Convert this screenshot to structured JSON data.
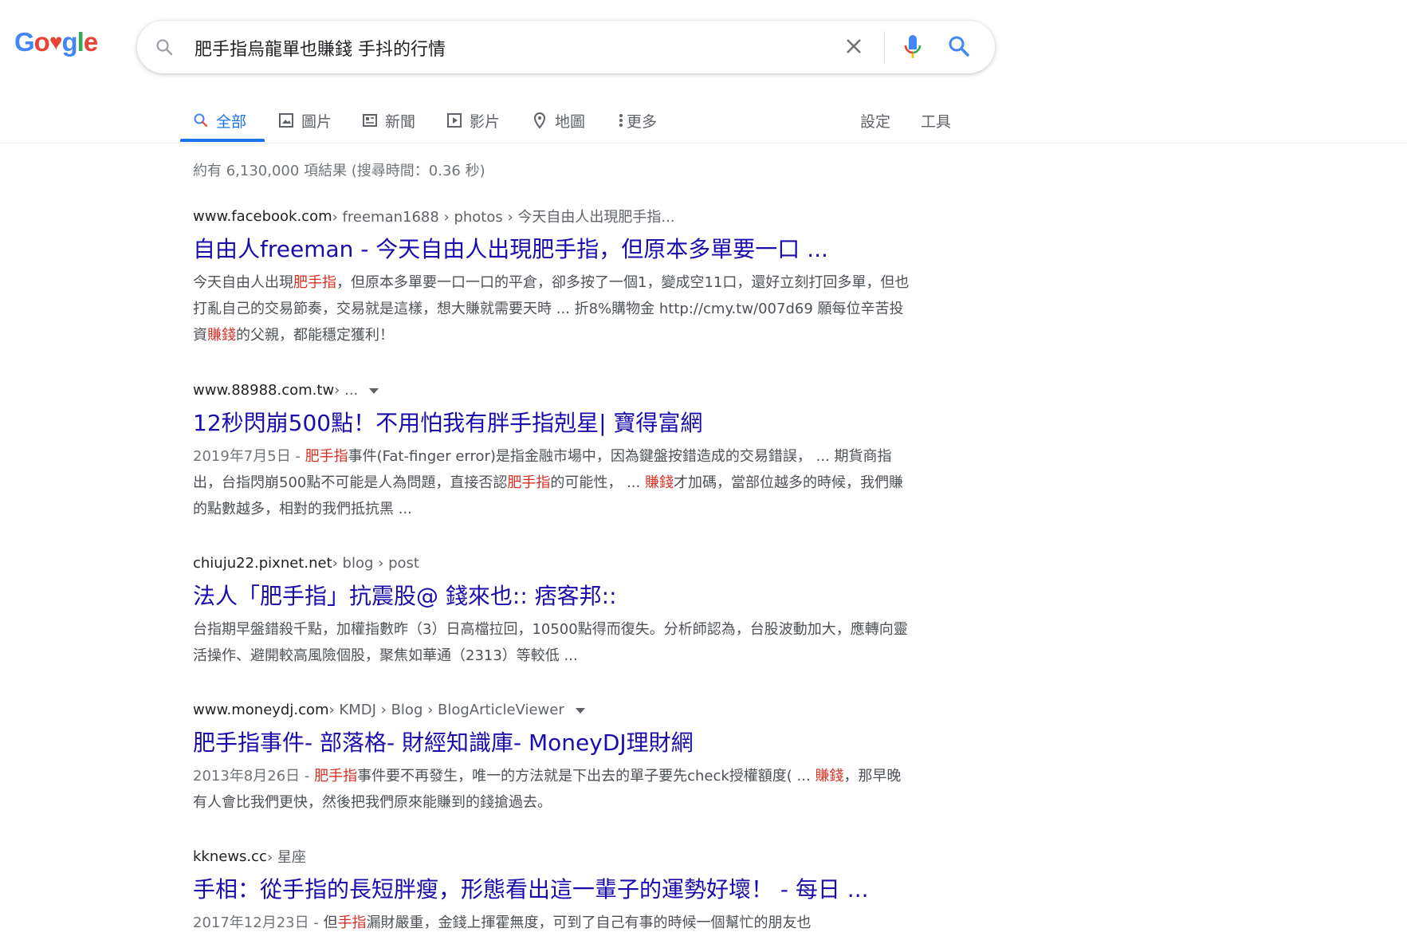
{
  "logo": {
    "letters": [
      "G",
      "o",
      "♥",
      "g",
      "l",
      "e"
    ],
    "colors": [
      "#4285f4",
      "#ea4335",
      "#ea4335",
      "#4285f4",
      "#34a853",
      "#ea4335"
    ]
  },
  "search": {
    "query": "肥手指烏龍單也賺錢 手抖的行情"
  },
  "tabs": [
    {
      "label": "全部",
      "icon": "search-icon"
    },
    {
      "label": "圖片",
      "icon": "image-icon"
    },
    {
      "label": "新聞",
      "icon": "news-icon"
    },
    {
      "label": "影片",
      "icon": "video-icon"
    },
    {
      "label": "地圖",
      "icon": "map-pin-icon"
    },
    {
      "label": "更多",
      "icon": "more-vert-icon"
    }
  ],
  "tab_right": {
    "settings": "設定",
    "tools": "工具"
  },
  "stats": "約有 6,130,000 項結果 (搜尋時間：0.36 秒)",
  "results": [
    {
      "site": "www.facebook.com",
      "path": " › freeman1688 › photos › 今天自由人出現肥手指...",
      "title": "自由人freeman - 今天自由人出現肥手指，但原本多單要一口 ...",
      "snippet": [
        {
          "t": "今天自由人出現"
        },
        {
          "t": "肥手指",
          "hl": true
        },
        {
          "t": "，但原本多單要一口一口的平倉，卻多按了一個1，變成空11口，還好立刻打回多單，但也打亂自己的交易節奏，交易就是這樣，想大賺就需要天時 ... 折8%購物金 http://cmy.tw/007d69 願每位辛苦投資"
        },
        {
          "t": "賺錢",
          "hl": true
        },
        {
          "t": "的父親，都能穩定獲利！"
        }
      ]
    },
    {
      "site": "www.88988.com.tw",
      "path": " › ...",
      "caret": true,
      "title": "12秒閃崩500點！不用怕我有胖手指剋星| 寶得富網",
      "date": "2019年7月5日 - ",
      "snippet": [
        {
          "t": "肥手指",
          "hl": true
        },
        {
          "t": "事件(Fat-finger error)是指金融市場中，因為鍵盤按錯造成的交易錯誤， ... 期貨商指出，台指閃崩500點不可能是人為問題，直接否認"
        },
        {
          "t": "肥手指",
          "hl": true
        },
        {
          "t": "的可能性， ... "
        },
        {
          "t": "賺錢",
          "hl": true
        },
        {
          "t": "才加碼，當部位越多的時候，我們賺的點數越多，相對的我們抵抗黑 ..."
        }
      ]
    },
    {
      "site": "chiuju22.pixnet.net",
      "path": " › blog › post",
      "title": "法人「肥手指」抗震股@ 錢來也:: 痞客邦::",
      "snippet": [
        {
          "t": "台指期早盤錯殺千點，加權指數昨（3）日高檔拉回，10500點得而復失。分析師認為，台股波動加大，應轉向靈活操作、避開較高風險個股，聚焦如華通（2313）等較低 ..."
        }
      ]
    },
    {
      "site": "www.moneydj.com",
      "path": " › KMDJ › Blog › BlogArticleViewer",
      "caret": true,
      "title": "肥手指事件- 部落格- 財經知識庫- MoneyDJ理財網",
      "date": "2013年8月26日 - ",
      "snippet": [
        {
          "t": "肥手指",
          "hl": true
        },
        {
          "t": "事件要不再發生，唯一的方法就是下出去的單子要先check授權額度( ... "
        },
        {
          "t": "賺錢",
          "hl": true
        },
        {
          "t": "，那早晚有人會比我們更快，然後把我們原來能賺到的錢搶過去。"
        }
      ]
    },
    {
      "site": "kknews.cc",
      "path": " › 星座",
      "title": "手相：從手指的長短胖瘦，形態看出這一輩子的運勢好壞！ - 每日 ...",
      "date": "2017年12月23日 - ",
      "snippet": [
        {
          "t": "但"
        },
        {
          "t": "手指",
          "hl": true
        },
        {
          "t": "漏財嚴重，金錢上揮霍無度，可到了自己有事的時候一個幫忙的朋友也"
        }
      ]
    }
  ]
}
